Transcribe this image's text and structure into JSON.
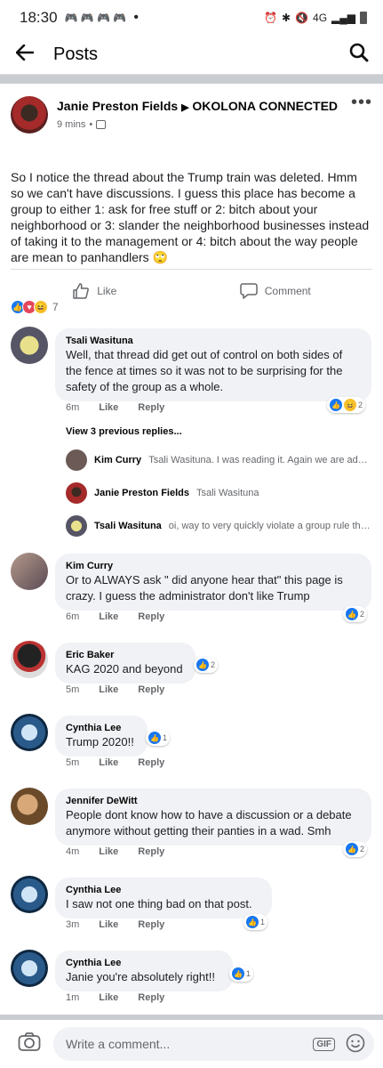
{
  "status_bar": {
    "time": "18:30",
    "network": "4G",
    "dot": "•"
  },
  "header": {
    "title": "Posts"
  },
  "post": {
    "author": "Janie Preston Fields",
    "arrow": "▶",
    "group": "OKOLONA CONNECTED",
    "time": "9 mins",
    "dot": "•",
    "text": "So I notice the thread about the Trump train was deleted. Hmm so we can't have discussions. I guess this place has become a group to either 1: ask for free stuff or 2: bitch about your neighborhood or 3: slander the neighborhood businesses instead of taking it to the management or 4: bitch about the way people are mean to panhandlers 🙄",
    "like_label": "Like",
    "comment_label": "Comment",
    "reaction_count": "7"
  },
  "comments": [
    {
      "name": "Tsali Wasituna",
      "text": "Well, that thread did get out of control on both sides of the fence at times so it was  not to be surprising for the safety of the group as a whole.",
      "time": "6m",
      "like": "Like",
      "reply": "Reply",
      "reactions": "2"
    },
    {
      "name": "Kim Curry",
      "text": "Or to ALWAYS ask \" did anyone hear that\" this page is crazy. I guess the administrator don't like Trump",
      "time": "6m",
      "like": "Like",
      "reply": "Reply",
      "reactions": "2"
    },
    {
      "name": "Eric Baker",
      "text": "KAG 2020 and beyond",
      "time": "5m",
      "like": "Like",
      "reply": "Reply",
      "reactions": "2"
    },
    {
      "name": "Cynthia Lee",
      "text": "Trump 2020!!",
      "time": "5m",
      "like": "Like",
      "reply": "Reply",
      "reactions": "1"
    },
    {
      "name": "Jennifer DeWitt",
      "text": "People dont know how to have a discussion or a debate anymore without getting their panties in a wad. Smh",
      "time": "4m",
      "like": "Like",
      "reply": "Reply",
      "reactions": "2"
    },
    {
      "name": "Cynthia Lee",
      "text": "I saw not one thing bad on that post.",
      "time": "3m",
      "like": "Like",
      "reply": "Reply",
      "reactions": "1"
    },
    {
      "name": "Cynthia Lee",
      "text": "Janie you're absolutely right!!",
      "time": "1m",
      "like": "Like",
      "reply": "Reply",
      "reactions": "1"
    }
  ],
  "view_previous": "View 3 previous replies...",
  "replies": [
    {
      "name": "Kim Curry",
      "preview": "Tsali Wasituna. I was reading it. Again we are adul..."
    },
    {
      "name": "Janie Preston Fields",
      "preview": "Tsali Wasituna"
    },
    {
      "name": "Tsali Wasituna",
      "preview": "oi, way to very quickly violate a group rule the..."
    }
  ],
  "composer": {
    "placeholder": "Write a comment...",
    "gif": "GIF"
  },
  "colors": {
    "like_blue": "#1877f2",
    "bubble": "#f0f2f5",
    "divider": "#c9ccd1"
  }
}
